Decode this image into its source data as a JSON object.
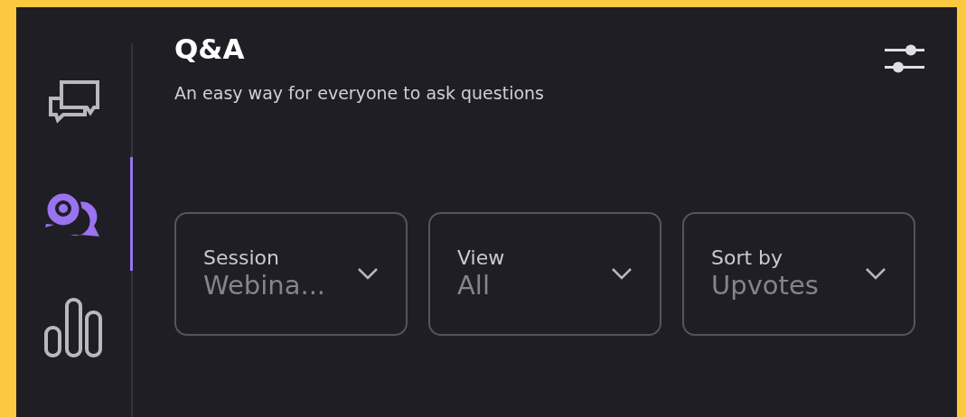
{
  "sidebar": {
    "items": [
      {
        "kind": "chat",
        "selected": false
      },
      {
        "kind": "qa",
        "selected": true
      },
      {
        "kind": "polls",
        "selected": false
      }
    ]
  },
  "header": {
    "title": "Q&A",
    "subtitle": "An easy way for everyone to ask questions"
  },
  "filters": [
    {
      "label": "Session",
      "value": "Webina..."
    },
    {
      "label": "View",
      "value": "All"
    },
    {
      "label": "Sort by",
      "value": "Upvotes"
    }
  ]
}
